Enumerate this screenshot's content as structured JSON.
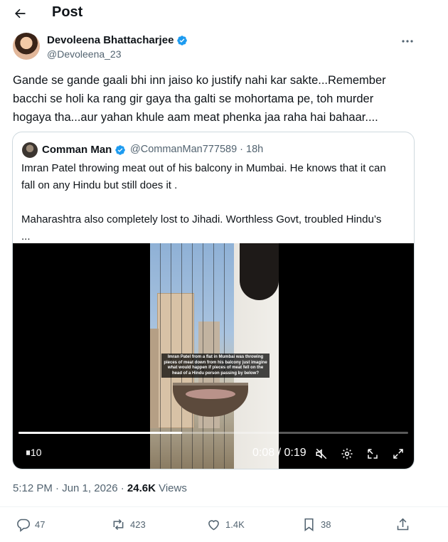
{
  "header": {
    "title": "Post"
  },
  "author": {
    "name": "Devoleena Bhattacharjee",
    "handle": "@Devoleena_23"
  },
  "tweet": {
    "lines": [
      "Gande se gande gaali bhi inn jaiso ko justify nahi kar sakte...Remember",
      "bacchi se holi ka rang gir gaya tha galti se mohortama pe, toh murder",
      "hogaya tha...aur yahan khule aam meat phenka jaa raha hai bahaar...."
    ]
  },
  "quote": {
    "name": "Comman Man",
    "handle": "@CommanMan777589",
    "time": "18h",
    "lines": [
      "Imran Patel throwing meat out of his balcony in Mumbai. He knows that it can",
      "fall on any Hindu but still does it .",
      "",
      "Maharashtra also completely lost to Jihadi. Worthless Govt, troubled Hindu’s",
      "..."
    ],
    "video": {
      "caption": "Imran Patel from a flat in Mumbai was throwing pieces of meat down from his balcony just imagine what would happen if pieces of meat fell on the head of a Hindu person passing by below?",
      "progress_fraction": 0.42,
      "play_label": "10",
      "time_display": "0:08 / 0:19"
    }
  },
  "meta": {
    "time": "5:12 PM · Jun 1, 2026 · ",
    "views_count": "24.6K",
    "views_label": " Views"
  },
  "actions": {
    "replies": "47",
    "reposts": "423",
    "likes": "1.4K",
    "bookmarks": "38"
  },
  "colors": {
    "verified": "#1d9bf0",
    "secondary_text": "#536471",
    "border": "#cfd9de"
  }
}
